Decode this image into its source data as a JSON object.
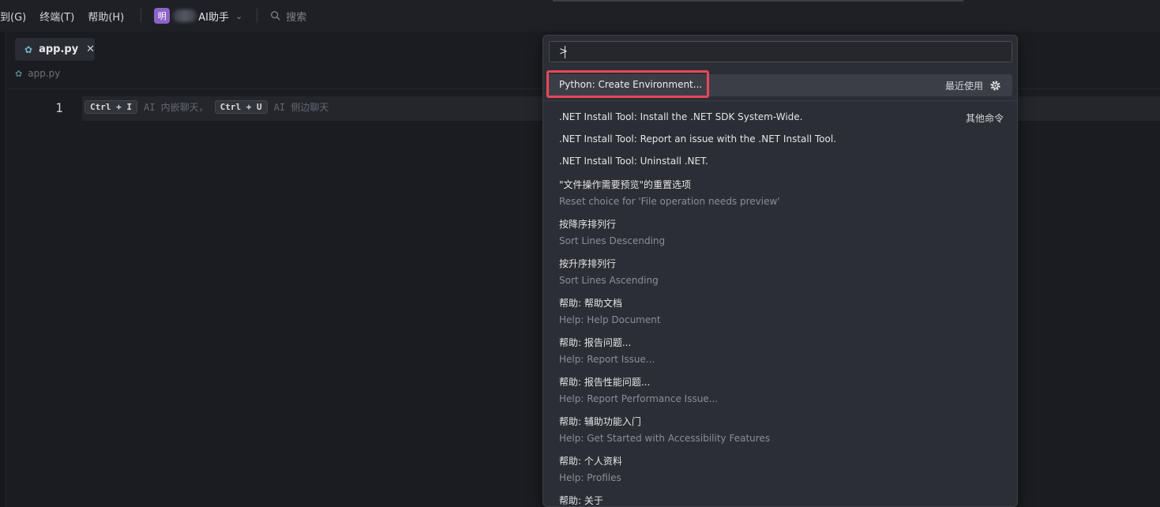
{
  "menu": {
    "items": [
      "到(G)",
      "终端(T)",
      "帮助(H)"
    ],
    "project_badge": "明",
    "project_name": "AI助手",
    "search_placeholder": "搜索"
  },
  "editor": {
    "tab_label": "app.py",
    "tab_close": "✕",
    "breadcrumb": "app.py",
    "line_number": "1",
    "hint": {
      "kbd1": "Ctrl + I",
      "text1": "AI 内嵌聊天，",
      "kbd2": "Ctrl + U",
      "text2": "AI 侧边聊天"
    }
  },
  "palette": {
    "input_value": ">",
    "selected": {
      "label": "Python: Create Environment...",
      "tag": "最近使用"
    },
    "group_label": "其他命令",
    "commands": [
      {
        "title": ".NET Install Tool: Install the .NET SDK System-Wide."
      },
      {
        "title": ".NET Install Tool: Report an issue with the .NET Install Tool."
      },
      {
        "title": ".NET Install Tool: Uninstall .NET."
      },
      {
        "title": "\"文件操作需要预览\"的重置选项",
        "subtitle": "Reset choice for 'File operation needs preview'"
      },
      {
        "title": "按降序排列行",
        "subtitle": "Sort Lines Descending"
      },
      {
        "title": "按升序排列行",
        "subtitle": "Sort Lines Ascending"
      },
      {
        "title": "帮助: 帮助文档",
        "subtitle": "Help: Help Document"
      },
      {
        "title": "帮助: 报告问题...",
        "subtitle": "Help: Report Issue..."
      },
      {
        "title": "帮助: 报告性能问题...",
        "subtitle": "Help: Report Performance Issue..."
      },
      {
        "title": "帮助: 辅助功能入门",
        "subtitle": "Help: Get Started with Accessibility Features"
      },
      {
        "title": "帮助: 个人资料",
        "subtitle": "Help: Profiles"
      },
      {
        "title": "帮助: 关于"
      }
    ]
  }
}
